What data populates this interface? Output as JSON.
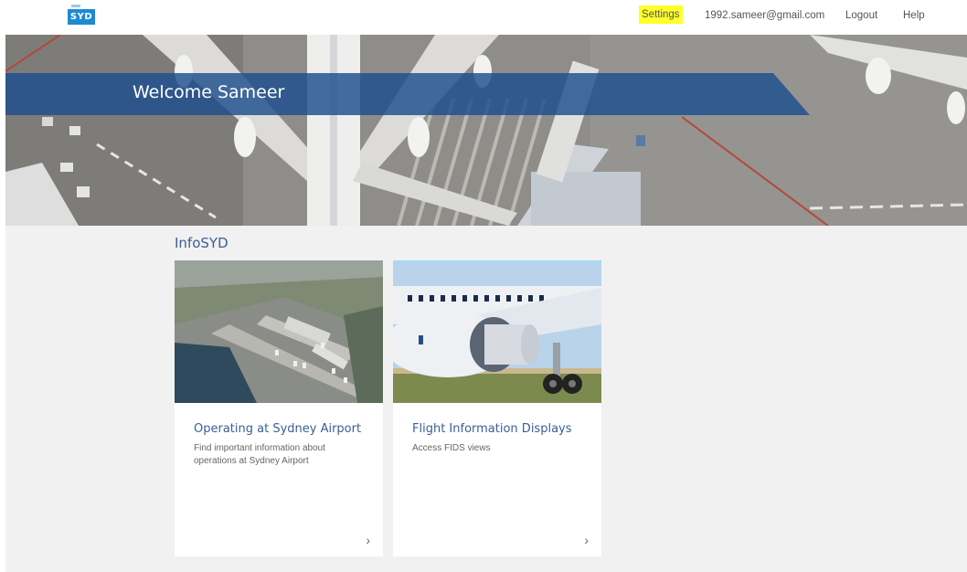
{
  "header": {
    "logo_text": "SYD",
    "nav": {
      "settings": "Settings",
      "email": "1992.sameer@gmail.com",
      "logout": "Logout",
      "help": "Help"
    },
    "highlight_color": "#ffff2a"
  },
  "hero": {
    "welcome": "Welcome Sameer",
    "banner_color": "#1c4e8e"
  },
  "main": {
    "section_title": "InfoSYD",
    "cards": [
      {
        "title": "Operating at Sydney Airport",
        "description": "Find important information about operations at Sydney Airport",
        "chevron": "›",
        "image": "aerial-airport-photo"
      },
      {
        "title": "Flight Information Displays",
        "description": "Access FIDS views",
        "chevron": "›",
        "image": "aircraft-engine-photo"
      }
    ]
  },
  "colors": {
    "accent": "#3a5f95",
    "logo": "#1f8ad1",
    "content_bg": "#f1f1f1"
  }
}
